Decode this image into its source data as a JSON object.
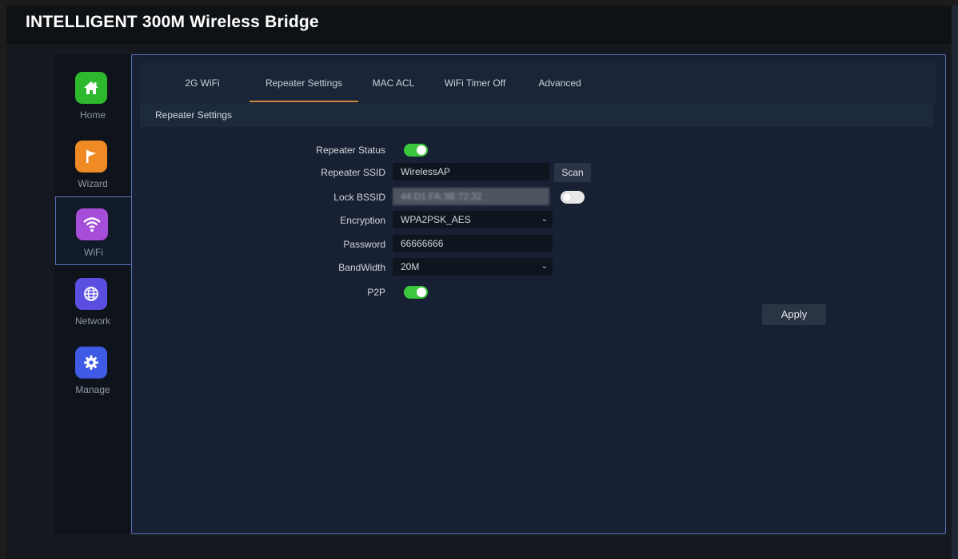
{
  "header": {
    "title": "INTELLIGENT 300M Wireless Bridge"
  },
  "sidebar": {
    "items": [
      {
        "label": "Home",
        "icon": "home-icon",
        "color": "#2eb82e"
      },
      {
        "label": "Wizard",
        "icon": "flag-icon",
        "color": "#f08a24"
      },
      {
        "label": "WiFi",
        "icon": "wifi-icon",
        "color": "#a64ed9",
        "active": true
      },
      {
        "label": "Network",
        "icon": "globe-icon",
        "color": "#5a4fe0"
      },
      {
        "label": "Manage",
        "icon": "gear-icon",
        "color": "#3f5be6"
      }
    ]
  },
  "tabs": [
    {
      "label": "2G WiFi"
    },
    {
      "label": "Repeater Settings",
      "active": true
    },
    {
      "label": "MAC ACL"
    },
    {
      "label": "WiFi Timer Off"
    },
    {
      "label": "Advanced"
    }
  ],
  "section": {
    "title": "Repeater Settings"
  },
  "form": {
    "repeater_status": {
      "label": "Repeater Status",
      "enabled": true
    },
    "repeater_ssid": {
      "label": "Repeater SSID",
      "value": "WirelessAP",
      "scan_label": "Scan"
    },
    "lock_bssid": {
      "label": "Lock BSSID",
      "value": "44:D1:FA:3B:72:32",
      "enabled": false
    },
    "encryption": {
      "label": "Encryption",
      "value": "WPA2PSK_AES"
    },
    "password": {
      "label": "Password",
      "value": "66666666"
    },
    "bandwidth": {
      "label": "BandWidth",
      "value": "20M"
    },
    "p2p": {
      "label": "P2P",
      "enabled": true
    }
  },
  "actions": {
    "apply_label": "Apply"
  },
  "colors": {
    "accent": "#d08a40",
    "toggle_on": "#3cc83c",
    "border": "#5c6fb8"
  }
}
